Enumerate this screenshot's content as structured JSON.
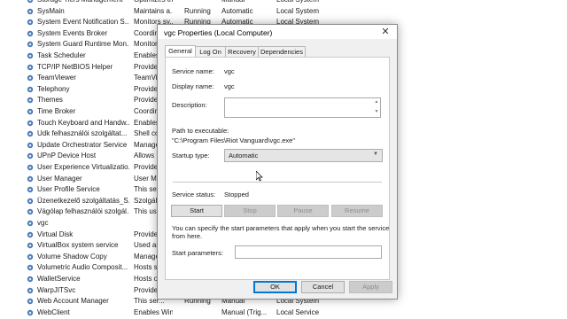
{
  "services": [
    {
      "name": "Storage Tiers Management",
      "description": "Optimizes th...",
      "status": "",
      "startup": "Manual",
      "logon": "Local System"
    },
    {
      "name": "SysMain",
      "description": "Maintains a...",
      "status": "Running",
      "startup": "Automatic",
      "logon": "Local System"
    },
    {
      "name": "System Event Notification S...",
      "description": "Monitors sy...",
      "status": "Running",
      "startup": "Automatic",
      "logon": "Local System"
    },
    {
      "name": "System Events Broker",
      "description": "Coordin",
      "status": "",
      "startup": "",
      "logon": ""
    },
    {
      "name": "System Guard Runtime Mon...",
      "description": "Monitor",
      "status": "",
      "startup": "",
      "logon": ""
    },
    {
      "name": "Task Scheduler",
      "description": "Enables",
      "status": "",
      "startup": "",
      "logon": ""
    },
    {
      "name": "TCP/IP NetBIOS Helper",
      "description": "Provide",
      "status": "",
      "startup": "",
      "logon": ""
    },
    {
      "name": "TeamViewer",
      "description": "TeamVie",
      "status": "",
      "startup": "",
      "logon": ""
    },
    {
      "name": "Telephony",
      "description": "Provide",
      "status": "",
      "startup": "",
      "logon": ""
    },
    {
      "name": "Themes",
      "description": "Provide",
      "status": "",
      "startup": "",
      "logon": ""
    },
    {
      "name": "Time Broker",
      "description": "Coordin",
      "status": "",
      "startup": "",
      "logon": ""
    },
    {
      "name": "Touch Keyboard and Handw...",
      "description": "Enables",
      "status": "",
      "startup": "",
      "logon": ""
    },
    {
      "name": "Udk felhasználói szolgáltat...",
      "description": "Shell co",
      "status": "",
      "startup": "",
      "logon": ""
    },
    {
      "name": "Update Orchestrator Service",
      "description": "Manage",
      "status": "",
      "startup": "",
      "logon": ""
    },
    {
      "name": "UPnP Device Host",
      "description": "Allows U",
      "status": "",
      "startup": "",
      "logon": ""
    },
    {
      "name": "User Experience Virtualizatio...",
      "description": "Provide",
      "status": "",
      "startup": "",
      "logon": ""
    },
    {
      "name": "User Manager",
      "description": "User M",
      "status": "",
      "startup": "",
      "logon": ""
    },
    {
      "name": "User Profile Service",
      "description": "This ser",
      "status": "",
      "startup": "",
      "logon": ""
    },
    {
      "name": "Üzenetkezelő szolgáltatás_S...",
      "description": "Szolgál",
      "status": "",
      "startup": "",
      "logon": ""
    },
    {
      "name": "Vágólap felhasználói szolgál...",
      "description": "This us",
      "status": "",
      "startup": "",
      "logon": ""
    },
    {
      "name": "vgc",
      "description": "",
      "status": "",
      "startup": "",
      "logon": ""
    },
    {
      "name": "Virtual Disk",
      "description": "Provide",
      "status": "",
      "startup": "",
      "logon": ""
    },
    {
      "name": "VirtualBox system service",
      "description": "Used as",
      "status": "",
      "startup": "",
      "logon": ""
    },
    {
      "name": "Volume Shadow Copy",
      "description": "Manage",
      "status": "",
      "startup": "",
      "logon": ""
    },
    {
      "name": "Volumetric Audio Composit...",
      "description": "Hosts sp",
      "status": "",
      "startup": "",
      "logon": ""
    },
    {
      "name": "WalletService",
      "description": "Hosts o",
      "status": "",
      "startup": "",
      "logon": ""
    },
    {
      "name": "WarpJITSvc",
      "description": "Provide",
      "status": "",
      "startup": "",
      "logon": ""
    },
    {
      "name": "Web Account Manager",
      "description": "This ser...",
      "status": "Running",
      "startup": "Manual",
      "logon": "Local System"
    },
    {
      "name": "WebClient",
      "description": "Enables Win...",
      "status": "",
      "startup": "Manual (Trig...",
      "logon": "Local Service"
    }
  ],
  "dialog": {
    "title": "vgc Properties (Local Computer)",
    "close_glyph": "✕",
    "tabs": [
      "General",
      "Log On",
      "Recovery",
      "Dependencies"
    ],
    "service_name_label": "Service name:",
    "service_name_value": "vgc",
    "display_name_label": "Display name:",
    "display_name_value": "vgc",
    "description_label": "Description:",
    "description_value": "",
    "path_label": "Path to executable:",
    "path_value": "\"C:\\Program Files\\Riot Vanguard\\vgc.exe\"",
    "startup_type_label": "Startup type:",
    "startup_type_value": "Automatic",
    "service_status_label": "Service status:",
    "service_status_value": "Stopped",
    "buttons": {
      "start": "Start",
      "stop": "Stop",
      "pause": "Pause",
      "resume": "Resume"
    },
    "hint_text_line1": "You can specify the start parameters that apply when you start the service",
    "hint_text_line2": "from here.",
    "start_params_label": "Start parameters:",
    "start_params_value": "",
    "footer": {
      "ok": "OK",
      "cancel": "Cancel",
      "apply": "Apply"
    }
  },
  "colors": {
    "accent": "#0078d7",
    "gear_icon": "#4a7ab8"
  }
}
